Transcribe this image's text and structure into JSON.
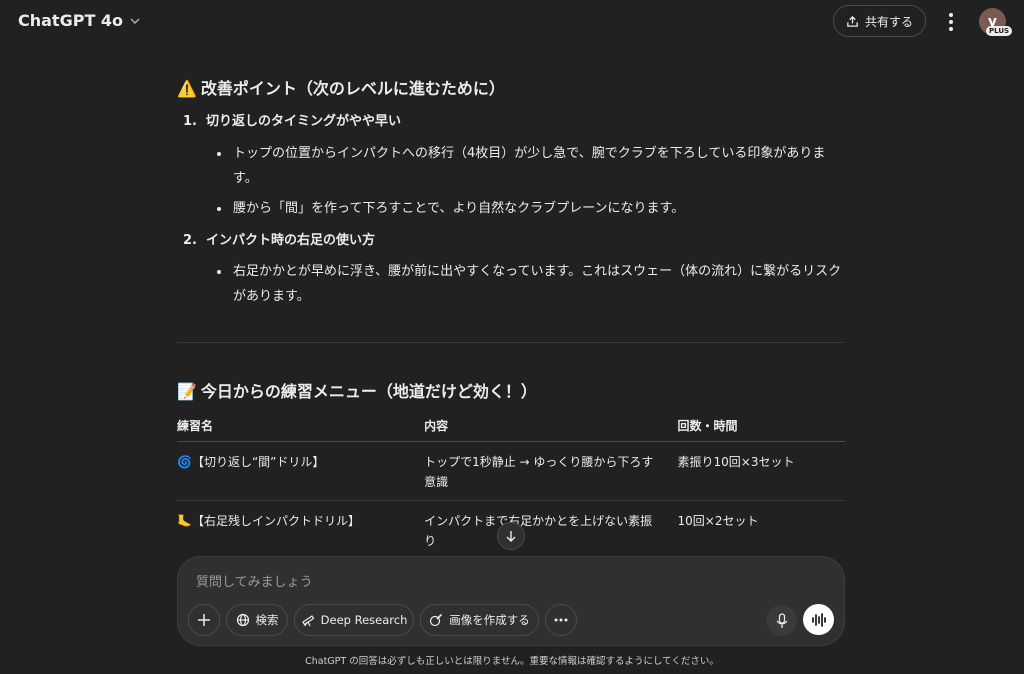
{
  "header": {
    "model_name": "ChatGPT 4o",
    "share_label": "共有する",
    "avatar_initial": "y",
    "plan_badge": "PLUS"
  },
  "improve": {
    "emoji": "⚠️",
    "heading": "改善ポイント（次のレベルに進むために）",
    "items": [
      {
        "number": "1.",
        "title": "切り返しのタイミングがやや早い",
        "bullets": [
          "トップの位置からインパクトへの移行（4枚目）が少し急で、腕でクラブを下ろしている印象があります。",
          "腰から「間」を作って下ろすことで、より自然なクラブプレーンになります。"
        ]
      },
      {
        "number": "2.",
        "title": "インパクト時の右足の使い方",
        "bullets": [
          "右足かかとが早めに浮き、腰が前に出やすくなっています。これはスウェー（体の流れ）に繋がるリスクがあります。"
        ]
      }
    ]
  },
  "practice": {
    "emoji": "📝",
    "heading": "今日からの練習メニュー（地道だけど効く！）",
    "columns": [
      "練習名",
      "内容",
      "回数・時間"
    ],
    "rows": [
      {
        "icon": "🌀",
        "name": "【切り返し“間”ドリル】",
        "content": "トップで1秒静止 → ゆっくり腰から下ろす意識",
        "reps": "素振り10回×3セット"
      },
      {
        "icon": "🦶",
        "name": "【右足残しインパクトドリル】",
        "content": "インパクトまで右足かかとを上げない素振り",
        "reps": "10回×2セット"
      }
    ]
  },
  "composer": {
    "placeholder": "質問してみましょう",
    "tools": {
      "search": "検索",
      "deep_research": "Deep Research",
      "create_image": "画像を作成する"
    }
  },
  "footer_note": "ChatGPT の回答は必ずしも正しいとは限りません。重要な情報は確認するようにしてください。",
  "colors": {
    "background": "#212121",
    "composer": "#303030",
    "text": "#ececec"
  },
  "icons": [
    "chevron-down-icon",
    "share-icon",
    "more-vertical-icon",
    "arrow-down-icon",
    "plus-icon",
    "globe-icon",
    "telescope-icon",
    "image-brush-icon",
    "ellipsis-icon",
    "microphone-icon",
    "voice-wave-icon"
  ]
}
